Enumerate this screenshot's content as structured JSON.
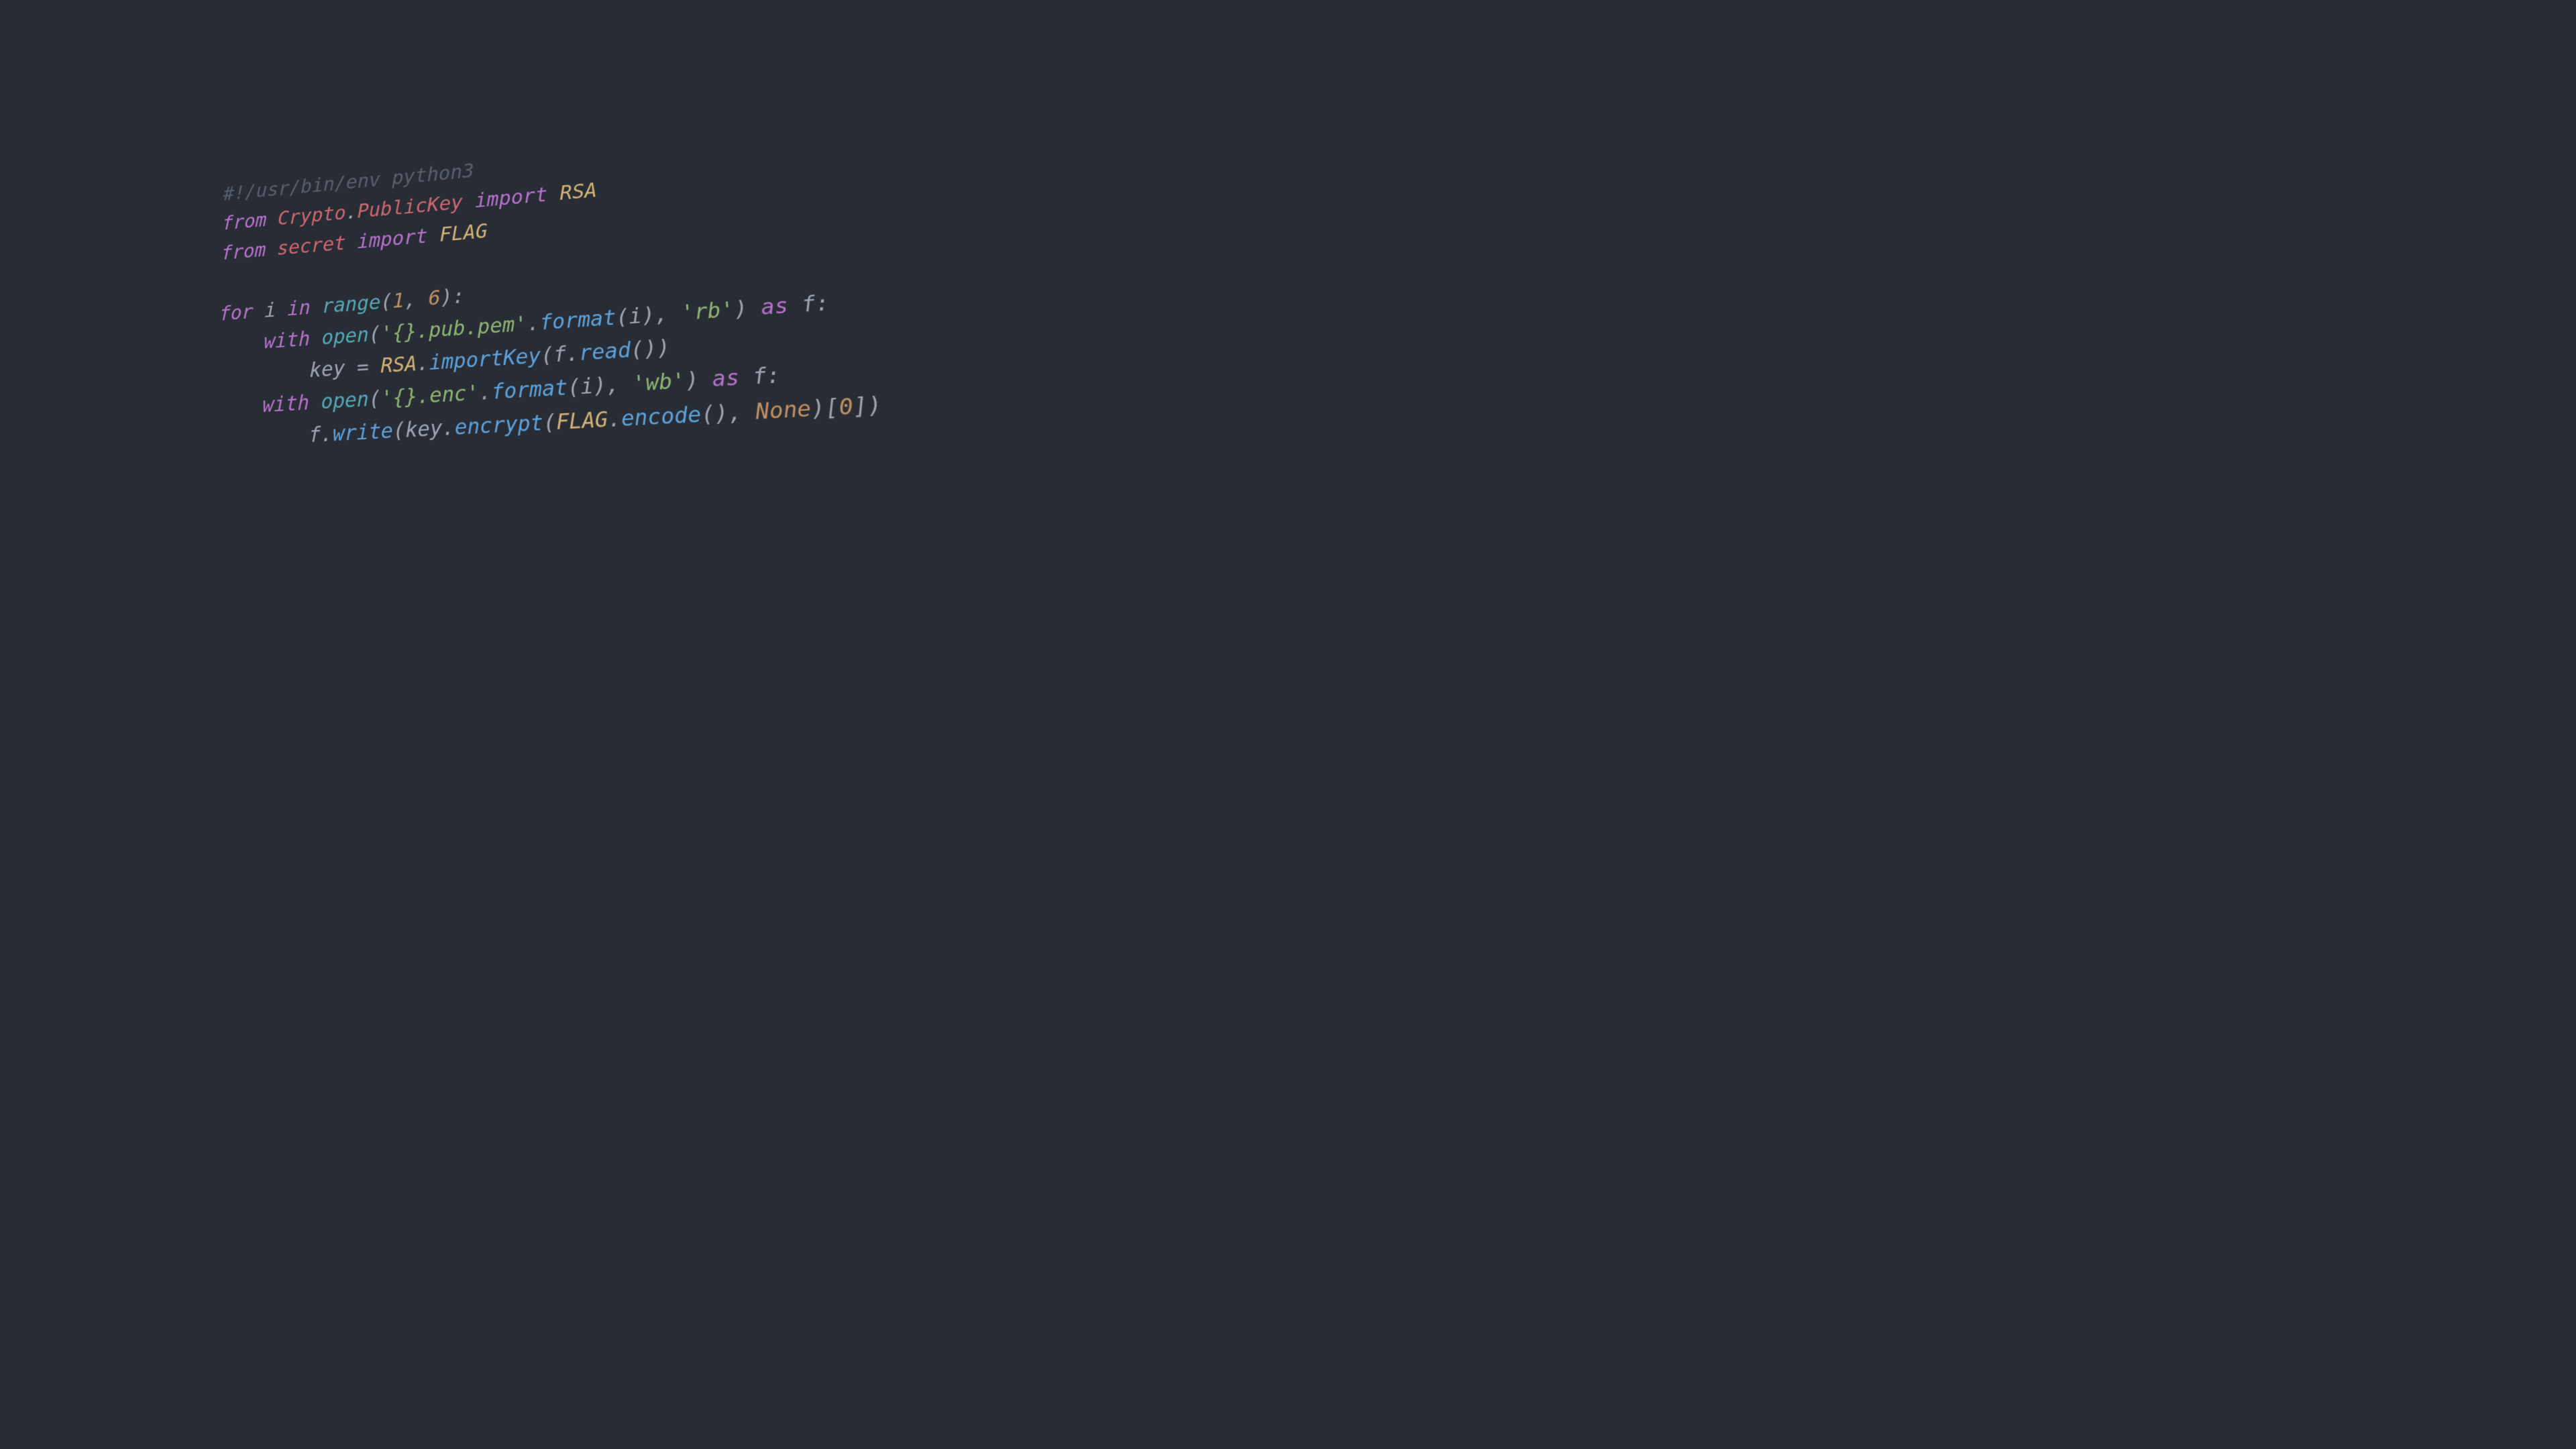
{
  "lines": [
    [
      {
        "cls": "c-comment",
        "text": "#!/usr/bin/env python3"
      }
    ],
    [
      {
        "cls": "c-keyword",
        "text": "from"
      },
      {
        "cls": "c-default",
        "text": " "
      },
      {
        "cls": "c-module",
        "text": "Crypto"
      },
      {
        "cls": "c-default",
        "text": "."
      },
      {
        "cls": "c-module",
        "text": "PublicKey"
      },
      {
        "cls": "c-default",
        "text": " "
      },
      {
        "cls": "c-keyword",
        "text": "import"
      },
      {
        "cls": "c-default",
        "text": " "
      },
      {
        "cls": "c-class",
        "text": "RSA"
      }
    ],
    [
      {
        "cls": "c-keyword",
        "text": "from"
      },
      {
        "cls": "c-default",
        "text": " "
      },
      {
        "cls": "c-module",
        "text": "secret"
      },
      {
        "cls": "c-default",
        "text": " "
      },
      {
        "cls": "c-keyword",
        "text": "import"
      },
      {
        "cls": "c-default",
        "text": " "
      },
      {
        "cls": "c-class",
        "text": "FLAG"
      }
    ],
    [
      {
        "cls": "c-default",
        "text": ""
      }
    ],
    [
      {
        "cls": "c-keyword",
        "text": "for"
      },
      {
        "cls": "c-default",
        "text": " i "
      },
      {
        "cls": "c-keyword",
        "text": "in"
      },
      {
        "cls": "c-default",
        "text": " "
      },
      {
        "cls": "c-builtin",
        "text": "range"
      },
      {
        "cls": "c-default",
        "text": "("
      },
      {
        "cls": "c-number",
        "text": "1"
      },
      {
        "cls": "c-default",
        "text": ", "
      },
      {
        "cls": "c-number",
        "text": "6"
      },
      {
        "cls": "c-default",
        "text": "):"
      }
    ],
    [
      {
        "cls": "c-default",
        "text": "    "
      },
      {
        "cls": "c-keyword",
        "text": "with"
      },
      {
        "cls": "c-default",
        "text": " "
      },
      {
        "cls": "c-builtin",
        "text": "open"
      },
      {
        "cls": "c-default",
        "text": "("
      },
      {
        "cls": "c-string",
        "text": "'{}.pub.pem'"
      },
      {
        "cls": "c-default",
        "text": "."
      },
      {
        "cls": "c-func",
        "text": "format"
      },
      {
        "cls": "c-default",
        "text": "(i), "
      },
      {
        "cls": "c-string",
        "text": "'rb'"
      },
      {
        "cls": "c-default",
        "text": ") "
      },
      {
        "cls": "c-keyword",
        "text": "as"
      },
      {
        "cls": "c-default",
        "text": " f:"
      }
    ],
    [
      {
        "cls": "c-default",
        "text": "        key = "
      },
      {
        "cls": "c-class",
        "text": "RSA"
      },
      {
        "cls": "c-default",
        "text": "."
      },
      {
        "cls": "c-func",
        "text": "importKey"
      },
      {
        "cls": "c-default",
        "text": "(f."
      },
      {
        "cls": "c-func",
        "text": "read"
      },
      {
        "cls": "c-default",
        "text": "())"
      }
    ],
    [
      {
        "cls": "c-default",
        "text": "    "
      },
      {
        "cls": "c-keyword",
        "text": "with"
      },
      {
        "cls": "c-default",
        "text": " "
      },
      {
        "cls": "c-builtin",
        "text": "open"
      },
      {
        "cls": "c-default",
        "text": "("
      },
      {
        "cls": "c-string",
        "text": "'{}.enc'"
      },
      {
        "cls": "c-default",
        "text": "."
      },
      {
        "cls": "c-func",
        "text": "format"
      },
      {
        "cls": "c-default",
        "text": "(i), "
      },
      {
        "cls": "c-string",
        "text": "'wb'"
      },
      {
        "cls": "c-default",
        "text": ") "
      },
      {
        "cls": "c-keyword",
        "text": "as"
      },
      {
        "cls": "c-default",
        "text": " f:"
      }
    ],
    [
      {
        "cls": "c-default",
        "text": "        f."
      },
      {
        "cls": "c-func",
        "text": "write"
      },
      {
        "cls": "c-default",
        "text": "(key."
      },
      {
        "cls": "c-func",
        "text": "encrypt"
      },
      {
        "cls": "c-default",
        "text": "("
      },
      {
        "cls": "c-class",
        "text": "FLAG"
      },
      {
        "cls": "c-default",
        "text": "."
      },
      {
        "cls": "c-func",
        "text": "encode"
      },
      {
        "cls": "c-default",
        "text": "(), "
      },
      {
        "cls": "c-const",
        "text": "None"
      },
      {
        "cls": "c-default",
        "text": ")["
      },
      {
        "cls": "c-number",
        "text": "0"
      },
      {
        "cls": "c-default",
        "text": "])"
      }
    ]
  ]
}
